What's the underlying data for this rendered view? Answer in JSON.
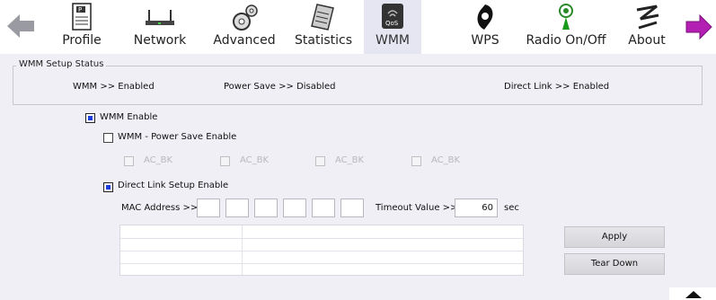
{
  "toolbar": {
    "items": [
      {
        "label": "Profile",
        "icon": "profile-icon"
      },
      {
        "label": "Network",
        "icon": "network-icon"
      },
      {
        "label": "Advanced",
        "icon": "advanced-icon"
      },
      {
        "label": "Statistics",
        "icon": "statistics-icon"
      },
      {
        "label": "WMM",
        "icon": "wmm-qos-icon",
        "icon_text": "QoS",
        "active": true
      },
      {
        "label": "WPS",
        "icon": "wps-icon"
      },
      {
        "label": "Radio On/Off",
        "icon": "radio-icon"
      },
      {
        "label": "About",
        "icon": "about-icon"
      }
    ]
  },
  "status": {
    "legend": "WMM Setup Status",
    "wmm": "WMM >> Enabled",
    "power_save": "Power Save >> Disabled",
    "direct_link": "Direct Link >> Enabled"
  },
  "wmm_enable": {
    "label": "WMM Enable",
    "checked": true
  },
  "power_save_enable": {
    "label": "WMM - Power Save Enable",
    "checked": false
  },
  "ac_options": [
    "AC_BK",
    "AC_BK",
    "AC_BK",
    "AC_BK"
  ],
  "direct_link": {
    "label": "Direct Link Setup Enable",
    "checked": true,
    "mac_label": "MAC Address >>",
    "timeout_label": "Timeout Value >>",
    "timeout_value": "60",
    "timeout_unit": "sec"
  },
  "buttons": {
    "apply": "Apply",
    "tear_down": "Tear Down"
  },
  "colors": {
    "accent": "#1a3fdc",
    "background": "#f0eff6"
  }
}
